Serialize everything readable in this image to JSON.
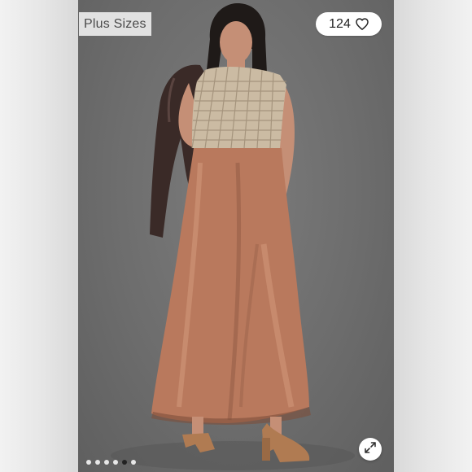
{
  "badge": {
    "label": "Plus Sizes"
  },
  "likes": {
    "count": "124",
    "icon": "heart-outline-icon"
  },
  "expand": {
    "icon": "expand-arrows-icon"
  },
  "carousel": {
    "total": 6,
    "active_index": 4
  },
  "colors": {
    "backdrop": "#6f6f6f",
    "dress_satin": "#b9795d",
    "crochet_top": "#cbbba3",
    "jacket": "#3a2a27",
    "hair": "#1f1a18",
    "skin": "#c58f76",
    "shoe": "#b07b52"
  }
}
